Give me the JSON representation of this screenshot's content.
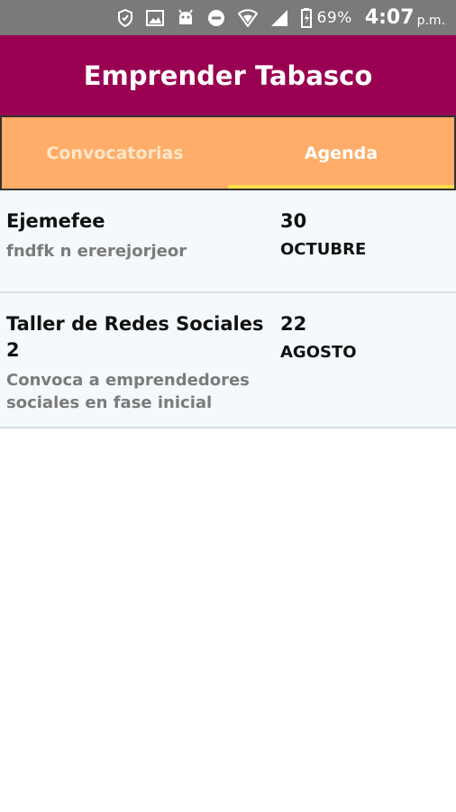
{
  "status_bar": {
    "icons": [
      "shield-icon",
      "image-icon",
      "android-icon",
      "do-not-disturb-icon",
      "wifi-icon",
      "signal-icon",
      "battery-icon"
    ],
    "battery": "69%",
    "time": "4:07",
    "ampm": "p.m."
  },
  "app_bar": {
    "title": "Emprender Tabasco",
    "color": "#990052"
  },
  "tabs": [
    {
      "label": "Convocatorias",
      "active": false
    },
    {
      "label": "Agenda",
      "active": true
    }
  ],
  "events": [
    {
      "title": "Ejemefee",
      "description": "fndfk n ererejorjeor",
      "day": "30",
      "month": "OCTUBRE"
    },
    {
      "title": "Taller de Redes Sociales 2",
      "description": "Convoca a emprendedores sociales en fase inicial",
      "day": "22",
      "month": "AGOSTO"
    }
  ],
  "colors": {
    "tab_bar": "#ffad68",
    "tab_indicator": "#ffe04a",
    "list_bg": "#f4f9fc"
  }
}
